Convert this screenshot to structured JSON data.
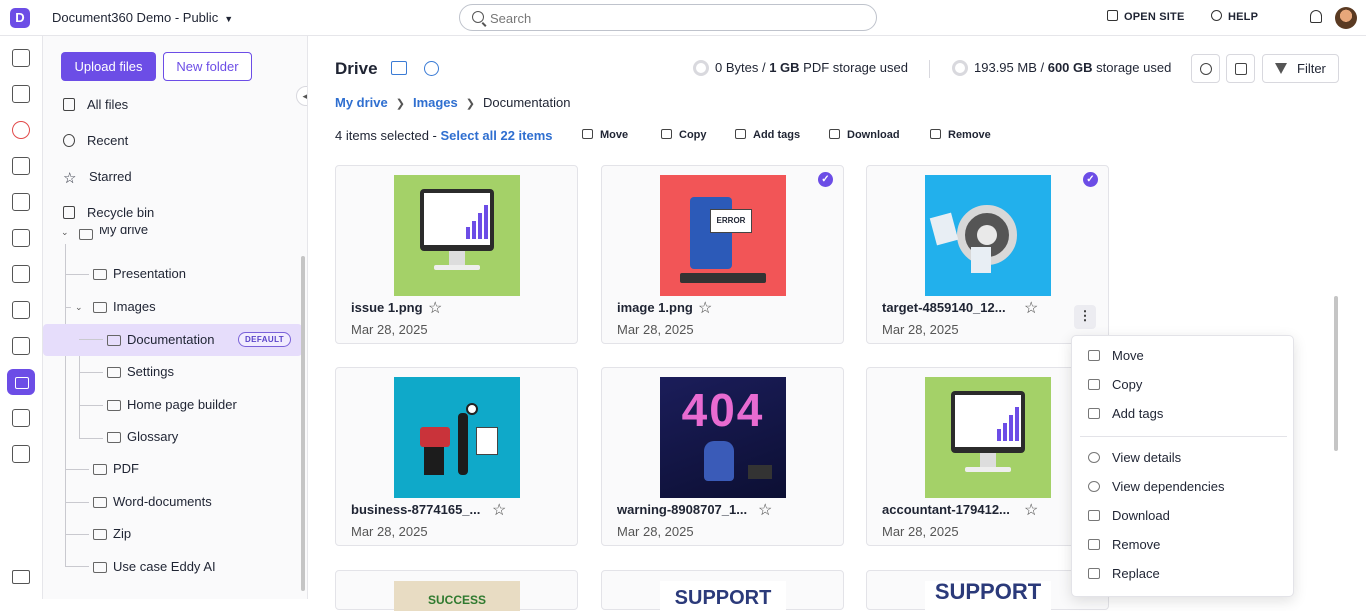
{
  "header": {
    "project_name": "Document360 Demo - Public",
    "search_placeholder": "Search",
    "open_site": "OPEN SITE",
    "help": "HELP"
  },
  "sidebar": {
    "upload_label": "Upload files",
    "new_folder_label": "New folder",
    "nav": [
      {
        "label": "All files",
        "icon": "files-icon"
      },
      {
        "label": "Recent",
        "icon": "history-icon"
      },
      {
        "label": "Starred",
        "icon": "star-icon"
      },
      {
        "label": "Recycle bin",
        "icon": "trash-icon"
      }
    ],
    "tree": {
      "root": "My drive",
      "items": [
        {
          "label": "Presentation"
        },
        {
          "label": "Images"
        },
        {
          "label": "Documentation",
          "badge": "DEFAULT"
        },
        {
          "label": "Settings"
        },
        {
          "label": "Home page builder"
        },
        {
          "label": "Glossary"
        },
        {
          "label": "PDF"
        },
        {
          "label": "Word-documents"
        },
        {
          "label": "Zip"
        },
        {
          "label": "Use case Eddy AI"
        }
      ]
    }
  },
  "main": {
    "title": "Drive",
    "pdf_storage": {
      "used": "0 Bytes",
      "total": "1 GB",
      "suffix": "PDF storage used"
    },
    "storage": {
      "used": "193.95 MB",
      "total": "600 GB",
      "suffix": "storage used"
    },
    "filter_label": "Filter",
    "breadcrumb": {
      "first": "My drive",
      "second": "Images",
      "current": "Documentation"
    },
    "selection": {
      "text": "4 items selected - ",
      "select_all": "Select all 22 items"
    },
    "actions": [
      "Move",
      "Copy",
      "Add tags",
      "Download",
      "Remove"
    ],
    "cards": [
      {
        "name": "issue 1.png",
        "date": "Mar 28, 2025",
        "selected": false
      },
      {
        "name": "image 1.png",
        "date": "Mar 28, 2025",
        "selected": true
      },
      {
        "name": "target-4859140_12...",
        "date": "Mar 28, 2025",
        "selected": true
      },
      {
        "name": "business-8774165_...",
        "date": "Mar 28, 2025",
        "selected": false
      },
      {
        "name": "warning-8908707_1...",
        "date": "Mar 28, 2025",
        "selected": false
      },
      {
        "name": "accountant-179412...",
        "date": "Mar 28, 2025",
        "selected": false
      }
    ],
    "thumb_texts": {
      "error": "ERROR",
      "notfound": "404",
      "success": "SUCCESS",
      "support1": "SUPPORT",
      "support2": "SUPPORT"
    }
  },
  "context_menu": {
    "items": [
      "Move",
      "Copy",
      "Add tags",
      "View details",
      "View dependencies",
      "Download",
      "Remove",
      "Replace"
    ]
  },
  "colors": {
    "accent": "#6c4de6",
    "link": "#2f6fd0"
  }
}
